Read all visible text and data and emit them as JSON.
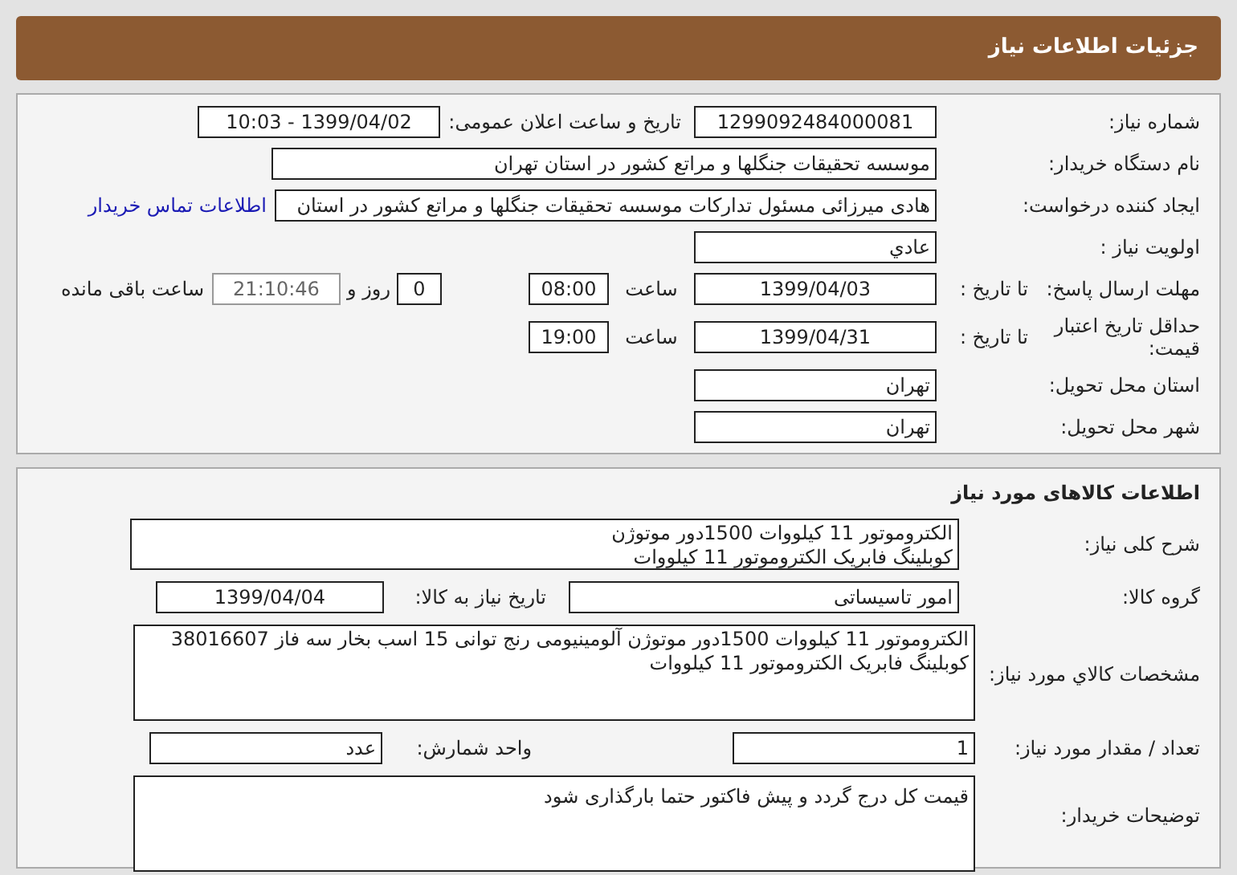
{
  "header": {
    "title": "جزئیات اطلاعات نیاز"
  },
  "need": {
    "need_number_label": "شماره نیاز:",
    "need_number": "1299092484000081",
    "announce_label": "تاریخ و ساعت اعلان عمومی:",
    "announce": "1399/04/02 - 10:03",
    "buyer_label": "نام دستگاه خریدار:",
    "buyer": "موسسه تحقیقات جنگلها و مراتع کشور در استان تهران",
    "creator_label": "ایجاد کننده درخواست:",
    "creator": "هادی میرزائی مسئول تدارکات موسسه تحقیقات جنگلها و مراتع کشور در استان",
    "contact_link": "اطلاعات تماس خریدار",
    "priority_label": "اولویت نیاز :",
    "priority": "عادي",
    "deadline_label": "مهلت ارسال پاسخ:",
    "deadline_to": "تا تاریخ :",
    "deadline_date": "1399/04/03",
    "deadline_time_label": "ساعت",
    "deadline_time": "08:00",
    "days": "0",
    "days_label": "روز و",
    "remaining": "21:10:46",
    "remaining_label": "ساعت باقی مانده",
    "validity_label": "حداقل تاریخ اعتبار قیمت:",
    "validity_to": "تا تاریخ :",
    "validity_date": "1399/04/31",
    "validity_time_label": "ساعت",
    "validity_time": "19:00",
    "province_label": "استان محل تحویل:",
    "province": "تهران",
    "city_label": "شهر محل تحویل:",
    "city": "تهران"
  },
  "goods": {
    "title": "اطلاعات کالاهای مورد نیاز",
    "summary_label": "شرح کلی نیاز:",
    "summary": [
      "الکتروموتور 11 کیلووات 1500دور موتوژن",
      "کوبلینگ فابریک الکتروموتور 11 کیلووات"
    ],
    "group_label": "گروه کالا:",
    "group": "امور تاسیساتی",
    "need_date_label": "تاریخ نیاز به کالا:",
    "need_date": "1399/04/04",
    "spec_label": "مشخصات کالاي مورد نیاز:",
    "spec": [
      "الکتروموتور 11 کیلووات 1500دور موتوژن آلومینیومی رنج توانی 15 اسب بخار سه فاز 38016607",
      "کوبلینگ فابریک الکتروموتور 11 کیلووات"
    ],
    "quantity_label": "تعداد / مقدار مورد نیاز:",
    "quantity": "1",
    "unit_label": "واحد شمارش:",
    "unit": "عدد",
    "notes_label": "توضیحات خریدار:",
    "notes": "قیمت کل درج گردد و پیش فاکتور حتما بارگذاری شود"
  }
}
